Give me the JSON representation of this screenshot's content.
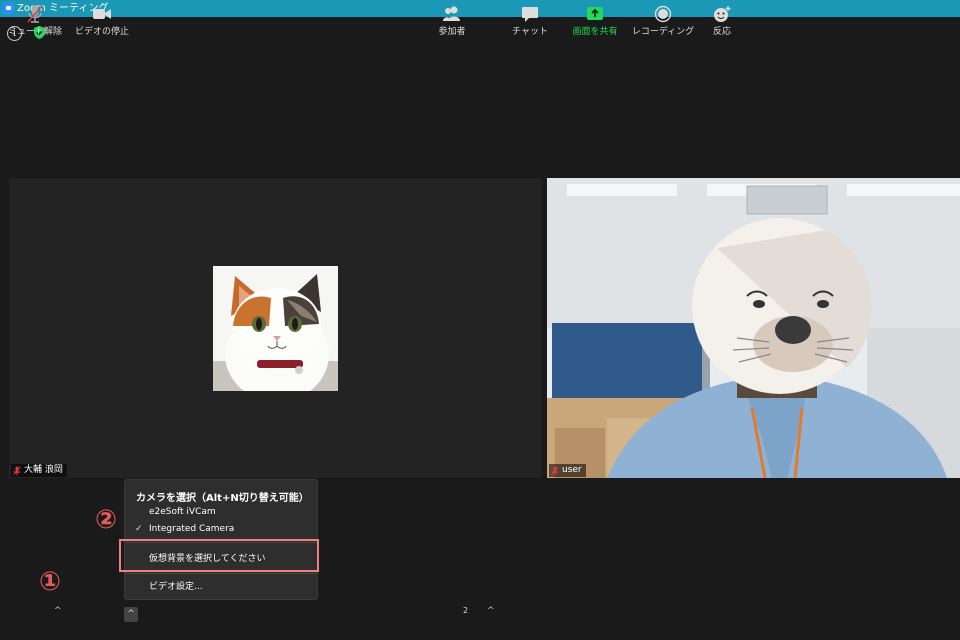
{
  "window": {
    "title": "Zoom ミーティング"
  },
  "participants": [
    {
      "name": "大輔 浪岡",
      "muted": true
    },
    {
      "name": "user",
      "muted": true
    }
  ],
  "camera_menu": {
    "title": "カメラを選択（Alt+N切り替え可能）",
    "cameras": [
      "e2eSoft iVCam",
      "Integrated Camera"
    ],
    "selected_camera": "Integrated Camera",
    "virtual_background": "仮想背景を選択してください",
    "video_settings": "ビデオ設定..."
  },
  "annotations": {
    "step1": "①",
    "step2": "②"
  },
  "toolbar": {
    "unmute": "ミュート解除",
    "stop_video": "ビデオの停止",
    "participants": "参加者",
    "participants_count": "2",
    "chat": "チャット",
    "share_screen": "画面を共有",
    "recording": "レコーディング",
    "reactions": "反応"
  },
  "colors": {
    "titlebar": "#1b98b5",
    "share_accent": "#23d959",
    "muted_red": "#e0393e",
    "highlight": "#f08080",
    "security_green": "#23d959"
  }
}
